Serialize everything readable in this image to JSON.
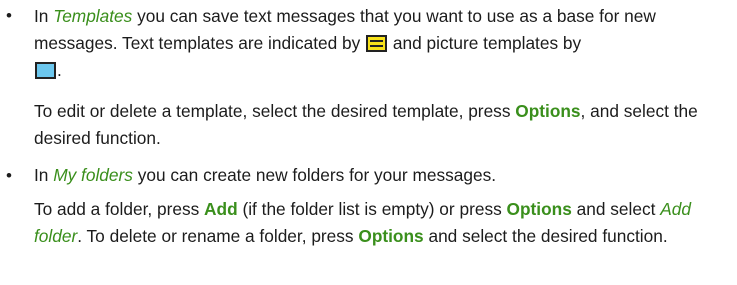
{
  "item1": {
    "bullet": "•",
    "p1": {
      "t0": "In ",
      "templates": "Templates",
      "t1": " you can save text messages that you want to use as a base for new messages. Text templates are indicated by ",
      "t2": " and picture templates by ",
      "t3": ".",
      "text_icon": "text-template-icon",
      "picture_icon": "picture-template-icon"
    },
    "p2": {
      "t0": "To edit or delete a template, select the desired template, press ",
      "options": "Options",
      "t1": ", and select the desired function."
    }
  },
  "item2": {
    "bullet": "•",
    "p1": {
      "t0": "In ",
      "my_folders": "My folders",
      "t1": " you can create new folders for your messages."
    },
    "p2": {
      "t0": "To add a folder, press ",
      "add": "Add",
      "t1": " (if the folder list is empty) or press ",
      "options1": "Options",
      "t2": " and select ",
      "add_folder": "Add folder",
      "t3": ". To delete or rename a folder, press ",
      "options2": "Options",
      "t4": " and select the desired function."
    }
  },
  "colors": {
    "accent_green": "#3a8f1c",
    "text": "#1c1c1c",
    "text_icon_fill": "#f7e21a",
    "picture_icon_fill": "#6cc7ee"
  }
}
